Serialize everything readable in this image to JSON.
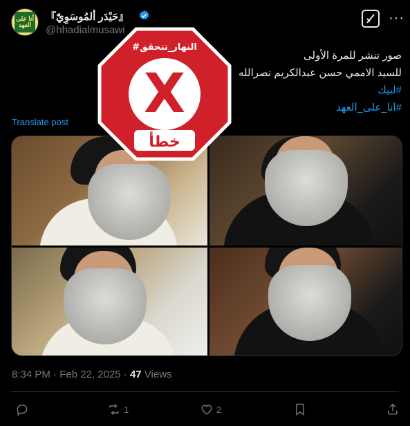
{
  "author": {
    "display_name": "『حَيْدَر ألمُوسَوِيّ』",
    "handle": "@hhadialmusawi",
    "avatar_text": "أنا على العهد"
  },
  "post": {
    "lines": [
      "صور تنشر للمرة الأولى",
      "للسيد الاممي حسن عبدالكريم نصرالله"
    ],
    "hashtags": [
      "#لبيك",
      "#انا_على_العهد"
    ],
    "translate_label": "Translate post",
    "time": "8:34 PM · Feb 22, 2025 · ",
    "views_count": "47",
    "views_label": " Views"
  },
  "stamp": {
    "top_text": "#النهار_تتحقق",
    "mark": "X",
    "verdict": "خطأ",
    "color": "#d0202a"
  },
  "actions": {
    "reply_count": "",
    "repost_count": "1",
    "like_count": "2"
  },
  "colors": {
    "accent": "#1d9bf0",
    "muted": "#71767b",
    "text": "#e7e9ea"
  }
}
